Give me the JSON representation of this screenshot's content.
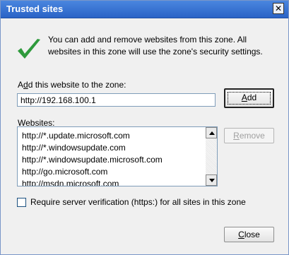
{
  "window": {
    "title": "Trusted sites"
  },
  "info": {
    "text": "You can add and remove websites from this zone. All websites in this zone will use the zone's security settings."
  },
  "add": {
    "label_key": "d",
    "label_rest_before": "A",
    "label_rest_after": "d this website to the zone:",
    "input_value": "http://192.168.100.1",
    "button_key": "A",
    "button_rest": "dd"
  },
  "websites": {
    "label_key": "W",
    "label_rest": "ebsites:",
    "items": [
      "http://*.update.microsoft.com",
      "http://*.windowsupdate.com",
      "http://*.windowsupdate.microsoft.com",
      "http://go.microsoft.com",
      "http://msdn.microsoft.com"
    ],
    "remove_key": "R",
    "remove_rest": "emove"
  },
  "options": {
    "require_https_label": "Require server verification (https:) for all sites in this zone",
    "require_https_checked": false
  },
  "footer": {
    "close_key": "C",
    "close_rest": "lose"
  },
  "colors": {
    "title_bar": "#2a63c6",
    "check_green": "#2e9a3c",
    "dialog_bg": "#f0f0f0"
  },
  "icons": {
    "title_close": "close-icon",
    "info": "checkmark-icon"
  }
}
